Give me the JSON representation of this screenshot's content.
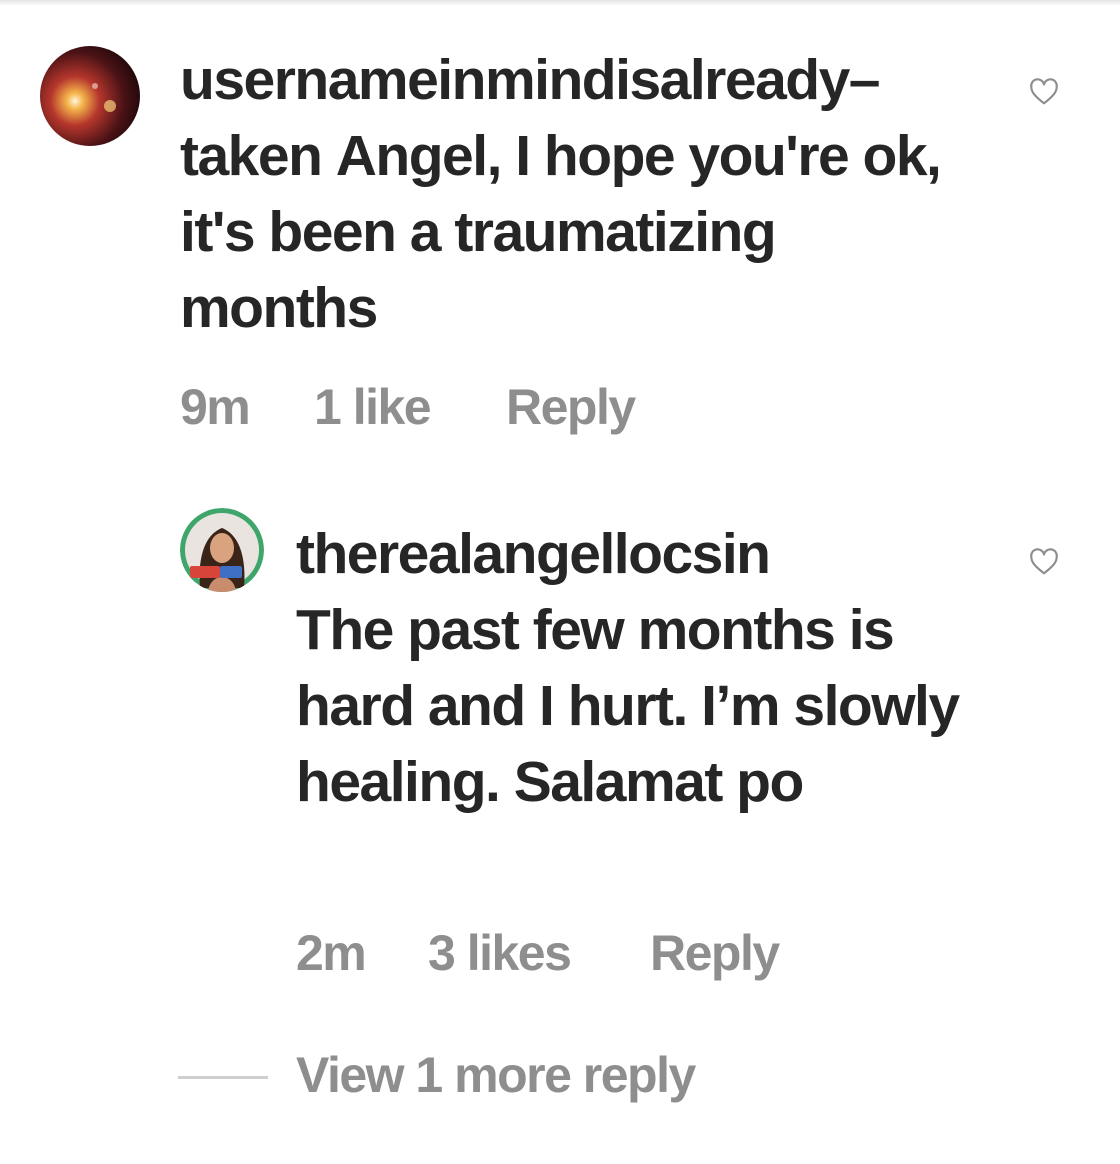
{
  "comments": [
    {
      "username": "usernameinmindisalready–taken",
      "text": "Angel, I hope you're ok, it's been a traumatizing months",
      "time": "9m",
      "likes": "1 like",
      "reply_label": "Reply",
      "avatar_icon": "user-avatar-icon"
    },
    {
      "username": "therealangellocsin",
      "text": "The past few months is hard and I hurt. I’m slowly healing. Salamat po",
      "time": "2m",
      "likes": "3 likes",
      "reply_label": "Reply",
      "avatar_icon": "user-avatar-icon"
    }
  ],
  "view_more_replies": "View 1 more reply",
  "icons": {
    "like": "heart-icon"
  },
  "colors": {
    "text": "#262626",
    "meta": "#8e8e8e",
    "divider": "#cfcfcf",
    "background": "#ffffff"
  }
}
